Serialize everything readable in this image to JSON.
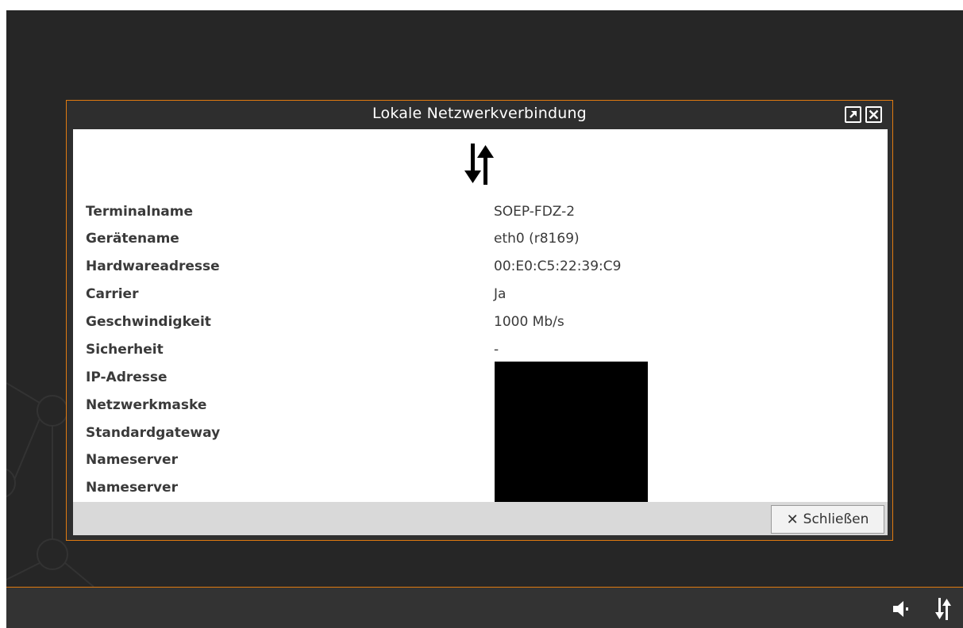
{
  "dialog": {
    "title": "Lokale Netzwerkverbindung",
    "detach_icon": "detach-icon",
    "close_icon": "close-icon",
    "network_icon": "network-updown-icon",
    "rows": [
      {
        "label": "Terminalname",
        "value": "SOEP-FDZ-2"
      },
      {
        "label": "Gerätename",
        "value": "eth0 (r8169)"
      },
      {
        "label": "Hardwareadresse",
        "value": "00:E0:C5:22:39:C9"
      },
      {
        "label": "Carrier",
        "value": "Ja"
      },
      {
        "label": "Geschwindigkeit",
        "value": "1000 Mb/s"
      },
      {
        "label": "Sicherheit",
        "value": "-"
      },
      {
        "label": "IP-Adresse",
        "value": ""
      },
      {
        "label": "Netzwerkmaske",
        "value": ""
      },
      {
        "label": "Standardgateway",
        "value": ""
      },
      {
        "label": "Nameserver",
        "value": ""
      },
      {
        "label": "Nameserver",
        "value": ""
      }
    ],
    "close_button": {
      "icon": "x-icon",
      "label": "Schließen"
    }
  },
  "taskbar": {
    "tray": [
      {
        "icon": "volume-icon"
      },
      {
        "icon": "network-updown-icon"
      }
    ]
  },
  "colors": {
    "accent": "#e07a10",
    "desktop": "#262626",
    "taskbar": "#333333"
  }
}
